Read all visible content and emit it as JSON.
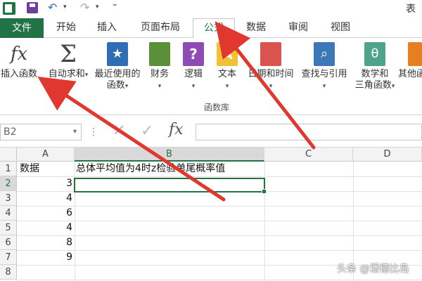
{
  "window": {
    "title_fragment": "表"
  },
  "tabs": {
    "file": "文件",
    "items": [
      "开始",
      "插入",
      "页面布局",
      "公式",
      "数据",
      "审阅",
      "视图"
    ],
    "active": "公式"
  },
  "ribbon": {
    "buttons": [
      {
        "icon": "insert-function-icon",
        "glyph": "fx",
        "label": "插入函数",
        "label2": ""
      },
      {
        "icon": "autosum-icon",
        "glyph": "Σ",
        "label": "自动求和",
        "label2": ""
      },
      {
        "icon": "recently-used-icon",
        "glyph": "★",
        "label": "最近使用的",
        "label2": "函数"
      },
      {
        "icon": "financial-icon",
        "glyph": "",
        "label": "财务",
        "label2": ""
      },
      {
        "icon": "logical-icon",
        "glyph": "?",
        "label": "逻辑",
        "label2": ""
      },
      {
        "icon": "text-icon",
        "glyph": "A",
        "label": "文本",
        "label2": ""
      },
      {
        "icon": "date-time-icon",
        "glyph": "",
        "label": "日期和时间",
        "label2": ""
      },
      {
        "icon": "lookup-reference-icon",
        "glyph": "🔍",
        "label": "查找与引用",
        "label2": ""
      },
      {
        "icon": "math-trig-icon",
        "glyph": "θ",
        "label": "数学和",
        "label2": "三角函数"
      },
      {
        "icon": "more-functions-icon",
        "glyph": "",
        "label": "其他函",
        "label2": ""
      }
    ],
    "group_label": "函数库"
  },
  "formula_bar": {
    "name_box": "B2",
    "fx_label": "fx",
    "value": ""
  },
  "sheet": {
    "columns": [
      "A",
      "B",
      "C",
      "D"
    ],
    "selected_column": "B",
    "rows": [
      "1",
      "2",
      "3",
      "4",
      "5",
      "6",
      "7",
      "8"
    ],
    "selected_row": "2",
    "cells": {
      "A1": "数据",
      "B1": "总体平均值为4时z检验单尾概率值",
      "A2": "3",
      "A3": "4",
      "A4": "6",
      "A5": "4",
      "A6": "8",
      "A7": "9"
    }
  },
  "watermark": "头条 @潘德比岛",
  "colors": {
    "accent": "#217346",
    "arrow": "#e0382f"
  }
}
